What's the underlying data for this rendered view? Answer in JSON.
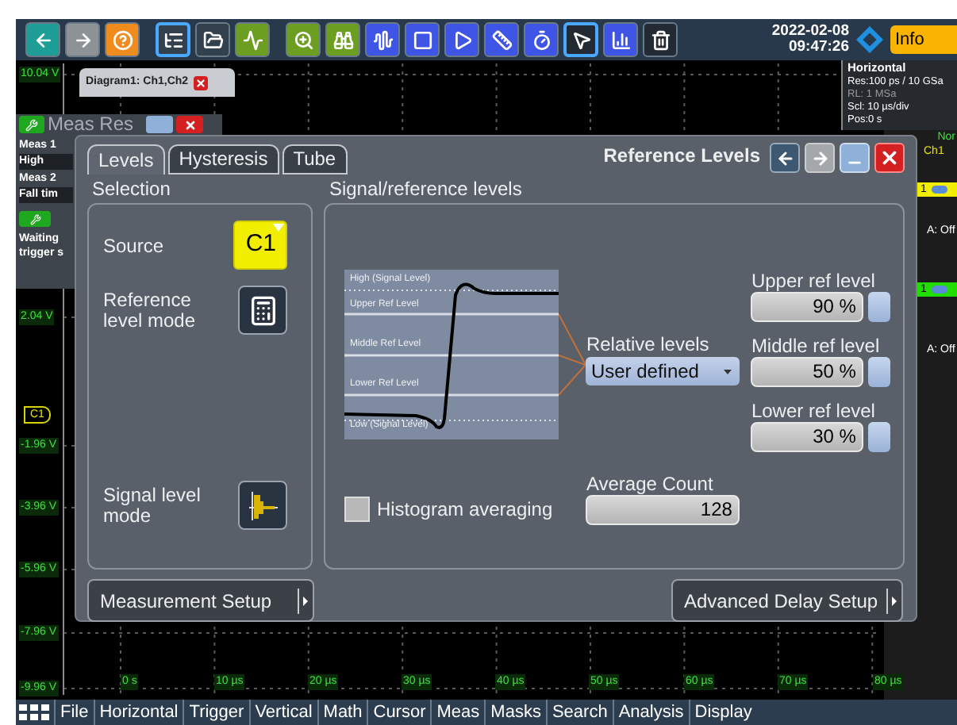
{
  "toolbar": [
    {
      "selected": false
    },
    {
      "selected": false
    },
    {
      "selected": false
    },
    {
      "selected": true
    },
    {
      "selected": false
    },
    {
      "selected": false
    },
    {
      "selected": false
    },
    {
      "selected": false
    },
    {
      "selected": false
    },
    {
      "selected": false
    },
    {
      "selected": false
    },
    {
      "selected": false
    },
    {
      "selected": false
    },
    {
      "selected": true
    },
    {
      "selected": false
    },
    {
      "selected": false
    }
  ],
  "datetime": {
    "date": "2022-02-08",
    "time": "09:47:26"
  },
  "info_button": "Info",
  "diagram_tab": {
    "label": "Diagram1: Ch1,Ch2"
  },
  "y_axis": [
    "10.04 V",
    "2.04 V",
    "-1.96 V",
    "-3.96 V",
    "-5.96 V",
    "-7.96 V",
    "-9.96 V"
  ],
  "x_axis": [
    "0 s",
    "10 µs",
    "20 µs",
    "30 µs",
    "40 µs",
    "50 µs",
    "60 µs",
    "70 µs",
    "80 µs"
  ],
  "channel_marker": "C1",
  "meas_results": {
    "title": "Meas Res",
    "items": [
      {
        "kind": "label",
        "text": "Meas 1"
      },
      {
        "kind": "value",
        "text": "High"
      },
      {
        "kind": "label",
        "text": "Meas 2"
      },
      {
        "kind": "value",
        "text": "Fall tim"
      }
    ],
    "status": [
      "Waiting",
      "trigger s"
    ]
  },
  "horizontal_panel": {
    "title": "Horizontal",
    "lines": [
      "Res:100 ps / 10 GSa",
      "RL: 1 MSa",
      "Scl: 10 µs/div",
      "Pos:0 s"
    ]
  },
  "trigger_panel": {
    "mode": "Nor",
    "source": "Ch1"
  },
  "channels": [
    {
      "label": "1",
      "color": "#f2ee00",
      "acq": "A: Off"
    },
    {
      "label": "1",
      "color": "#22dd00",
      "acq": "A: Off"
    }
  ],
  "dialog": {
    "title": "Reference Levels",
    "tabs": [
      {
        "label": "Levels",
        "selected": true
      },
      {
        "label": "Hysteresis",
        "selected": false
      },
      {
        "label": "Tube",
        "selected": false
      }
    ],
    "selection": {
      "title": "Selection",
      "source_label": "Source",
      "source_value": "C1",
      "reference_mode_label": "Reference level mode",
      "signal_mode_label": "Signal level mode"
    },
    "levels": {
      "title": "Signal/reference levels",
      "diagram_labels": [
        "High (Signal Level)",
        "Upper Ref Level",
        "Middle Ref Level",
        "Lower Ref Level",
        "Low (Signal Level)"
      ],
      "relative_label": "Relative levels",
      "relative_value": "User defined",
      "refs": [
        {
          "label": "Upper ref level",
          "value": "90 %"
        },
        {
          "label": "Middle ref level",
          "value": "50 %"
        },
        {
          "label": "Lower ref level",
          "value": "30 %"
        }
      ],
      "histogram": {
        "label": "Histogram averaging",
        "checked": false
      },
      "average": {
        "label": "Average Count",
        "value": "128"
      }
    },
    "buttons": [
      "Measurement Setup",
      "Advanced Delay Setup"
    ]
  },
  "menu": [
    "File",
    "Horizontal",
    "Trigger",
    "Vertical",
    "Math",
    "Cursor",
    "Meas",
    "Masks",
    "Search",
    "Analysis",
    "Display"
  ]
}
